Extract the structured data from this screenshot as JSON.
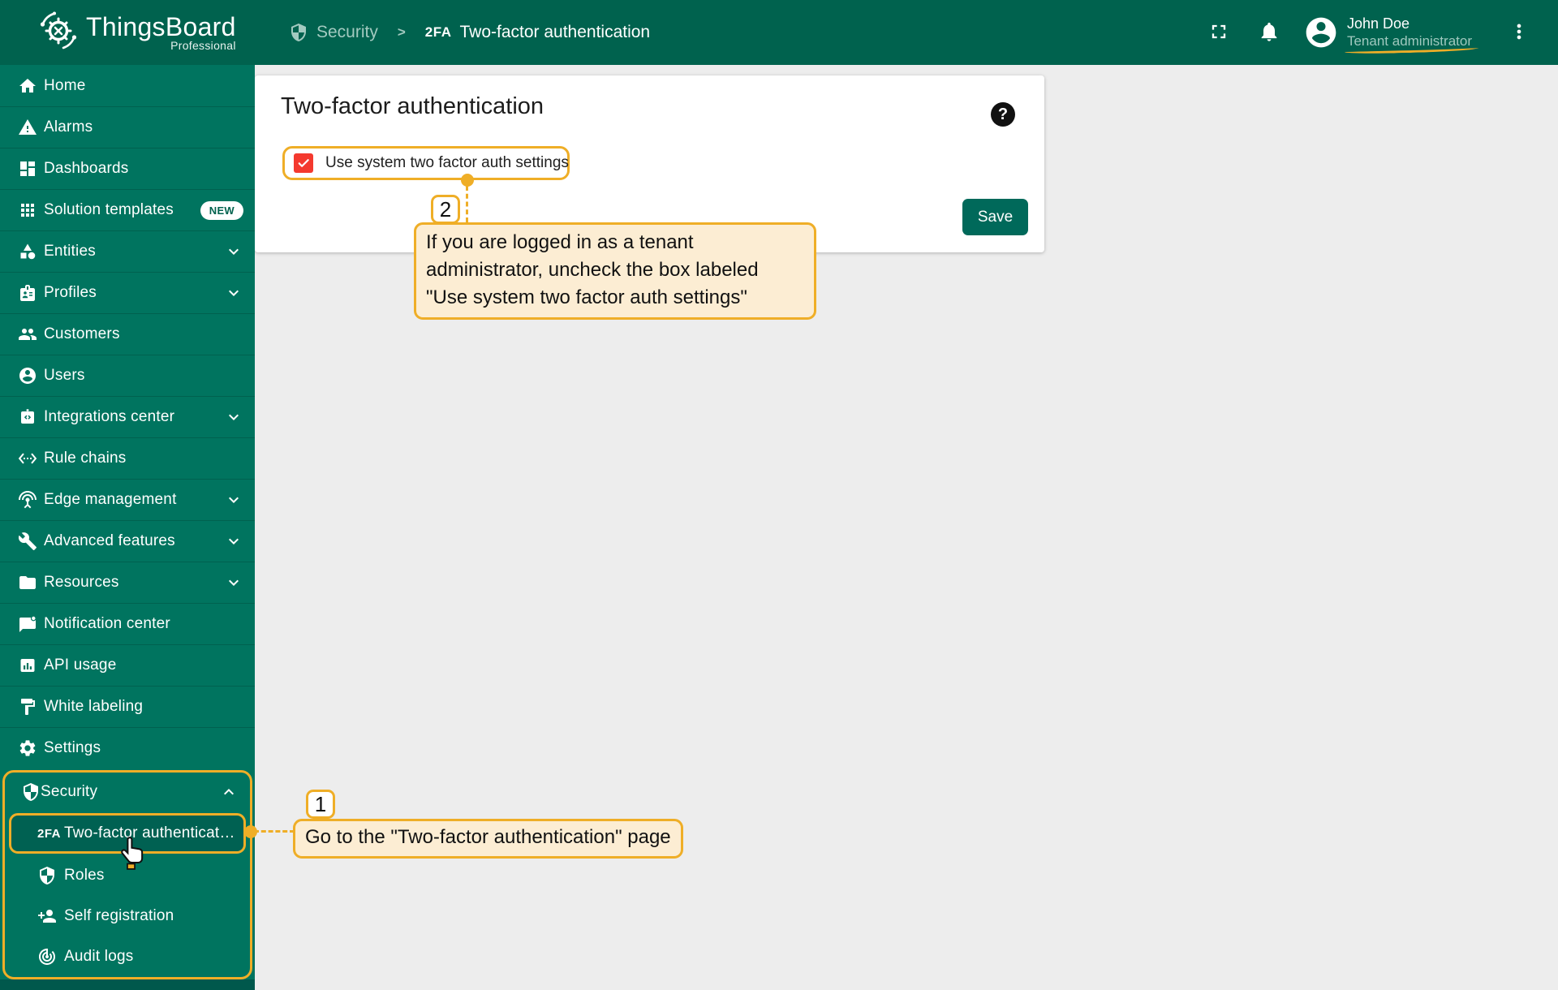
{
  "colors": {
    "header_green": "#00624e",
    "sidebar_green": "#00745f",
    "sidebar_bottom_green": "#00584c",
    "selected_item_green": "#006152",
    "annotation_amber": "#efae27",
    "annotation_cream": "#fcedd3",
    "checkbox_red": "#f4392e",
    "save_green": "#00695a",
    "content_gray": "#ededed"
  },
  "header": {
    "logo": {
      "title": "ThingsBoard",
      "subtitle": "Professional"
    },
    "breadcrumb": {
      "section": "Security",
      "separator": ">",
      "page_icon_text": "2FA",
      "page": "Two-factor authentication"
    },
    "user": {
      "name": "John Doe",
      "role": "Tenant administrator"
    }
  },
  "sidebar": {
    "items": [
      {
        "label": "Home",
        "icon": "home-icon"
      },
      {
        "label": "Alarms",
        "icon": "alarms-icon"
      },
      {
        "label": "Dashboards",
        "icon": "dashboards-icon"
      },
      {
        "label": "Solution templates",
        "icon": "solution-templates-icon",
        "badge": "NEW"
      },
      {
        "label": "Entities",
        "icon": "entities-icon",
        "expandable": true
      },
      {
        "label": "Profiles",
        "icon": "profiles-icon",
        "expandable": true
      },
      {
        "label": "Customers",
        "icon": "customers-icon"
      },
      {
        "label": "Users",
        "icon": "users-icon"
      },
      {
        "label": "Integrations center",
        "icon": "integrations-center-icon",
        "expandable": true
      },
      {
        "label": "Rule chains",
        "icon": "rule-chains-icon"
      },
      {
        "label": "Edge management",
        "icon": "edge-management-icon",
        "expandable": true
      },
      {
        "label": "Advanced features",
        "icon": "advanced-features-icon",
        "expandable": true
      },
      {
        "label": "Resources",
        "icon": "resources-icon",
        "expandable": true
      },
      {
        "label": "Notification center",
        "icon": "notification-center-icon"
      },
      {
        "label": "API usage",
        "icon": "api-usage-icon"
      },
      {
        "label": "White labeling",
        "icon": "white-labeling-icon"
      },
      {
        "label": "Settings",
        "icon": "settings-icon"
      }
    ],
    "security_group": {
      "label": "Security",
      "icon": "security-shield-icon",
      "expanded": true,
      "children": [
        {
          "label": "Two-factor authentication",
          "icon_text": "2FA",
          "selected": true
        },
        {
          "label": "Roles",
          "icon": "roles-shield-icon"
        },
        {
          "label": "Self registration",
          "icon": "self-registration-icon"
        },
        {
          "label": "Audit logs",
          "icon": "audit-logs-icon"
        }
      ]
    }
  },
  "main": {
    "card": {
      "title": "Two-factor authentication",
      "help_symbol": "?",
      "checkbox_label": "Use system two factor auth settings",
      "checkbox_checked": true,
      "save_label": "Save"
    }
  },
  "annotations": {
    "step1": {
      "number": "1",
      "text": "Go to the \"Two-factor authentication\" page"
    },
    "step2": {
      "number": "2",
      "text": "If you are logged in as a tenant administrator, uncheck the box labeled \"Use system two factor auth settings\""
    }
  }
}
